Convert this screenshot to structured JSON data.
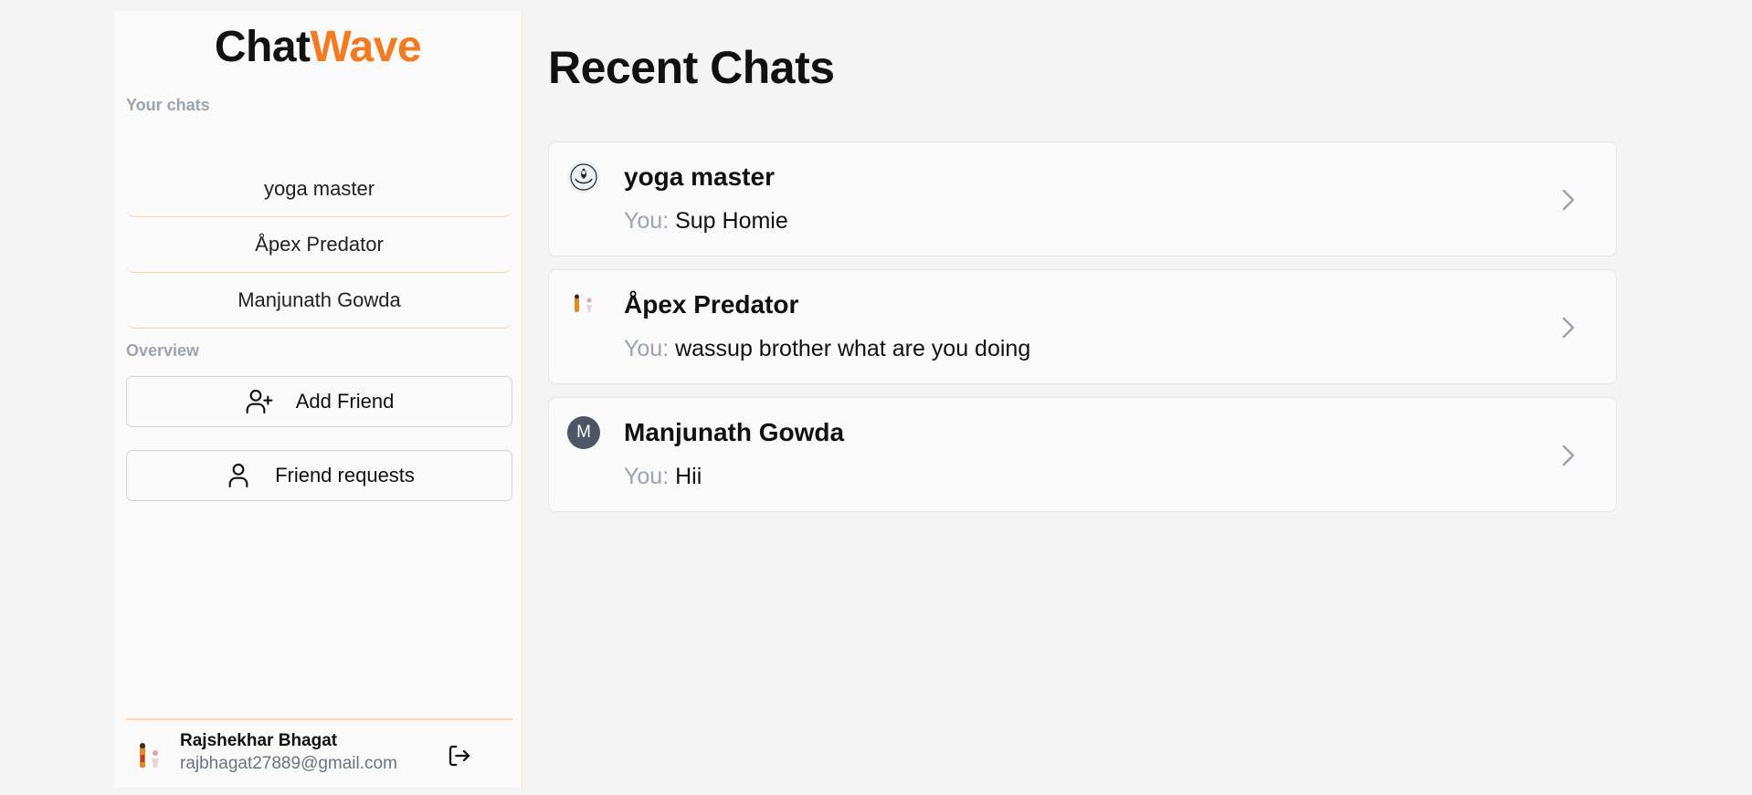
{
  "app": {
    "logo_part1": "Chat",
    "logo_part2": "Wave",
    "accent_color": "#f47a20"
  },
  "sidebar": {
    "your_chats_label": "Your chats",
    "chats": [
      {
        "label": "yoga master"
      },
      {
        "label": "Åpex Predator"
      },
      {
        "label": "Manjunath Gowda"
      }
    ],
    "overview_label": "Overview",
    "add_friend_label": "Add Friend",
    "add_friend_icon": "user-plus-icon",
    "friend_requests_label": "Friend requests",
    "friend_requests_icon": "user-icon"
  },
  "user": {
    "name": "Rajshekhar Bhagat",
    "email": "rajbhagat27889@gmail.com",
    "logout_icon": "logout-icon"
  },
  "main": {
    "title": "Recent Chats",
    "chats": [
      {
        "name": "yoga master",
        "prefix": "You:",
        "message": "Sup Homie",
        "avatar": "lotus-logo-avatar"
      },
      {
        "name": "Åpex Predator",
        "prefix": "You:",
        "message": "wassup brother what are you doing",
        "avatar": "figure-avatar"
      },
      {
        "name": "Manjunath Gowda",
        "prefix": "You:",
        "message": "Hii",
        "avatar_initial": "M",
        "avatar_color": "#4b5563"
      }
    ]
  }
}
